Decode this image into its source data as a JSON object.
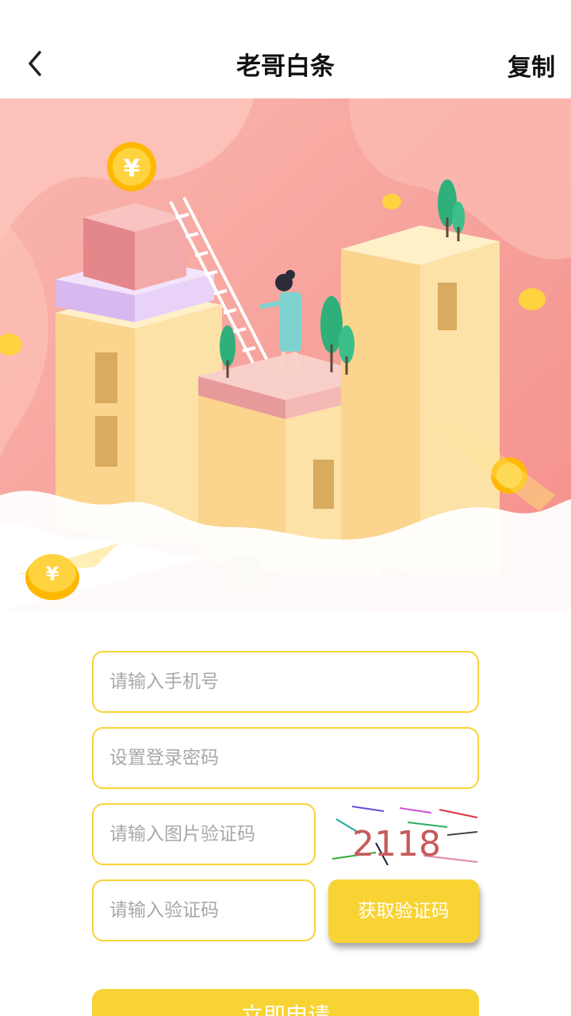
{
  "header": {
    "title": "老哥白条",
    "copy_label": "复制"
  },
  "hero": {
    "illustration": "city-buildings-with-coins",
    "currency_symbol": "¥"
  },
  "form": {
    "phone_placeholder": "请输入手机号",
    "password_placeholder": "设置登录密码",
    "image_code_placeholder": "请输入图片验证码",
    "sms_code_placeholder": "请输入验证码",
    "captcha_text": "2118",
    "get_code_label": "获取验证码",
    "submit_label": "立即申请"
  },
  "colors": {
    "accent": "#f8d334",
    "border": "#f7d337",
    "hero_pink": "#f8a4a0"
  }
}
